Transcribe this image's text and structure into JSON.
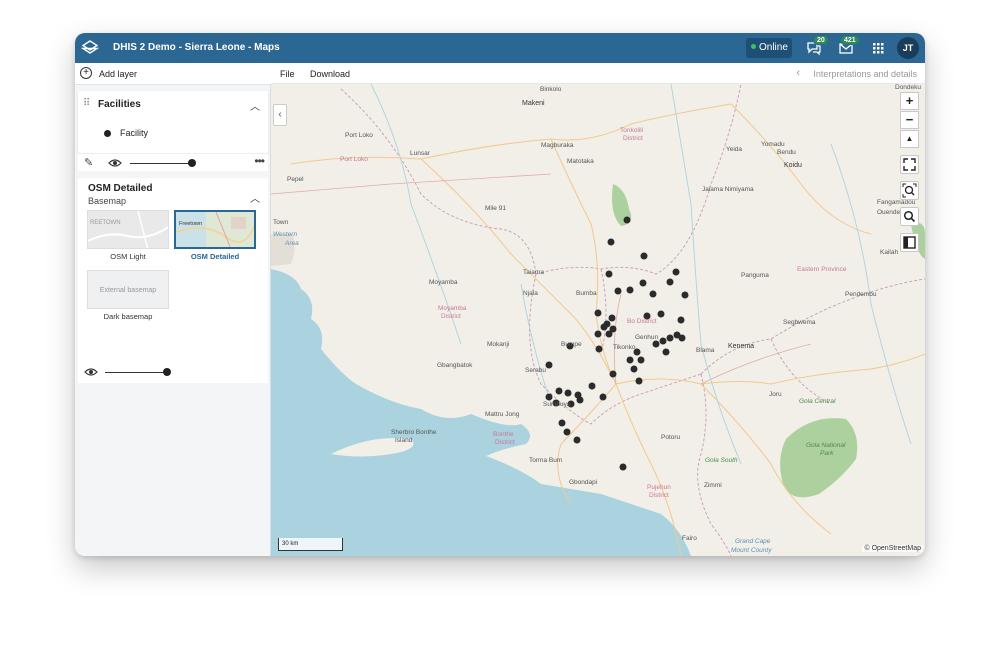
{
  "header": {
    "app_title": "DHIS 2 Demo - Sierra Leone - Maps",
    "online_label": "Online",
    "interpretations_count": "20",
    "messages_count": "421",
    "user_initials": "JT"
  },
  "sidebar": {
    "add_layer_label": "Add layer",
    "facilities": {
      "title": "Facilities",
      "legend_label": "Facility",
      "opacity": 1.0
    },
    "basemap": {
      "title": "OSM Detailed",
      "subtitle": "Basemap",
      "options": [
        {
          "label": "OSM Light",
          "thumb_text": "REETOWN",
          "selected": false
        },
        {
          "label": "OSM Detailed",
          "thumb_text": "Freetown",
          "selected": true
        },
        {
          "label": "Dark basemap",
          "thumb_text": "External basemap",
          "selected": false
        }
      ],
      "opacity": 1.0
    }
  },
  "menubar": {
    "file_label": "File",
    "download_label": "Download",
    "interpretations_label": "Interpretations and details"
  },
  "map": {
    "zoom_in": "+",
    "zoom_out": "−",
    "scale_label": "30 km",
    "attribution": "© OpenStreetMap",
    "places": {
      "binkolo": "Binkolo",
      "makeni": "Makeni",
      "tonkolili": "Tonkolili",
      "district": "District",
      "port_loko": "Port Loko",
      "lunsar": "Lunsar",
      "port_loko_district": "Port Loko",
      "magburaka": "Magburaka",
      "matotaka": "Matotaka",
      "yomadu": "Yomadu",
      "yeida": "Yeida",
      "bendu": "Bendu",
      "koidu": "Koidu",
      "pepel": "Pepel",
      "jaiama": "Jaiama Nimiyama",
      "mile91": "Mile 91",
      "fangamadou": "Fangamadou",
      "town": "Town",
      "western": "Western",
      "area": "Area",
      "ouende": "Ouende",
      "kailahun": "Kailah",
      "taiama": "Taiama",
      "moyamba": "Moyamba",
      "njala": "Njala",
      "bumba": "Bumba",
      "panguma": "Panguma",
      "eastern": "Eastern Province",
      "pendembu": "Pendembu",
      "moyamba_district": "Moyamba",
      "bo_district": "Bo District",
      "segbwema": "Segbwema",
      "mokanji": "Mokanji",
      "bumpe": "Bumpe",
      "tikonko": "Tikonko",
      "genhun": "Genhun",
      "blama": "Blama",
      "kenema": "Kenema",
      "gbangbatok": "Gbangbatok",
      "serabu": "Serabu",
      "joru": "Joru",
      "gola_central": "Gola Central",
      "mattru": "Mattru Jong",
      "sumbuya": "Sumbuya",
      "sherbro": "Sherbro Bonthe",
      "island": "Island",
      "bonthe": "Bonthe",
      "bonthe_district": "District",
      "potoru": "Potoru",
      "gola_national": "Gola National",
      "park": "Park",
      "torma": "Torma Bum",
      "gola_south": "Gola South",
      "zimmi": "Zimmi",
      "gbondapi": "Gbondapi",
      "pujehun": "Pujehun",
      "pujehun_district": "District",
      "fairo": "Fairo",
      "grand_cape": "Grand Cape",
      "mount_county": "Mount County",
      "dondeku": "Dondeku"
    }
  },
  "colors": {
    "header_bg": "#2c6693",
    "ocean": "#aad3df",
    "forest": "#add19e",
    "facility_dot": "#2b2b2b",
    "selected_border": "#2c6693"
  }
}
